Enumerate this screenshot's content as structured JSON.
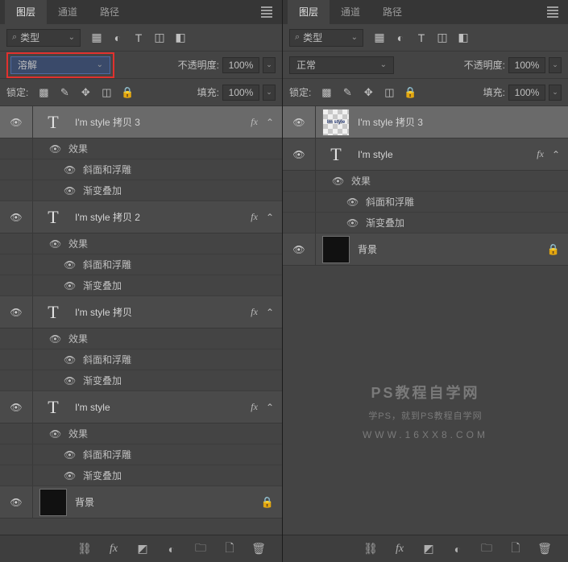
{
  "tabs": {
    "layers": "图层",
    "channels": "通道",
    "paths": "路径"
  },
  "filter": {
    "type_label": "类型"
  },
  "left": {
    "blend_mode": "溶解",
    "opacity_label": "不透明度:",
    "opacity_value": "100%",
    "lock_label": "锁定:",
    "fill_label": "填充:",
    "fill_value": "100%",
    "layers": [
      {
        "name": "I'm style 拷贝 3",
        "type": "text",
        "selected": true,
        "fx": true
      },
      {
        "name": "I'm style 拷贝 2",
        "type": "text",
        "fx": true
      },
      {
        "name": "I'm style 拷贝",
        "type": "text",
        "fx": true
      },
      {
        "name": "I'm style",
        "type": "text",
        "fx": true
      },
      {
        "name": "背景",
        "type": "dark",
        "locked": true
      }
    ],
    "effects": {
      "effects_label": "效果",
      "bevel": "斜面和浮雕",
      "gradient": "渐变叠加"
    }
  },
  "right": {
    "blend_mode": "正常",
    "opacity_label": "不透明度:",
    "opacity_value": "100%",
    "lock_label": "锁定:",
    "fill_label": "填充:",
    "fill_value": "100%",
    "layers": [
      {
        "name": "I'm style 拷贝 3",
        "type": "raster",
        "selected": true
      },
      {
        "name": "I'm style",
        "type": "text",
        "fx": true
      },
      {
        "name": "背景",
        "type": "dark",
        "locked": true
      }
    ],
    "effects": {
      "effects_label": "效果",
      "bevel": "斜面和浮雕",
      "gradient": "渐变叠加"
    }
  },
  "watermark": {
    "line1": "PS教程自学网",
    "line2": "学PS，就到PS教程自学网",
    "line3": "WWW.16XX8.COM"
  }
}
